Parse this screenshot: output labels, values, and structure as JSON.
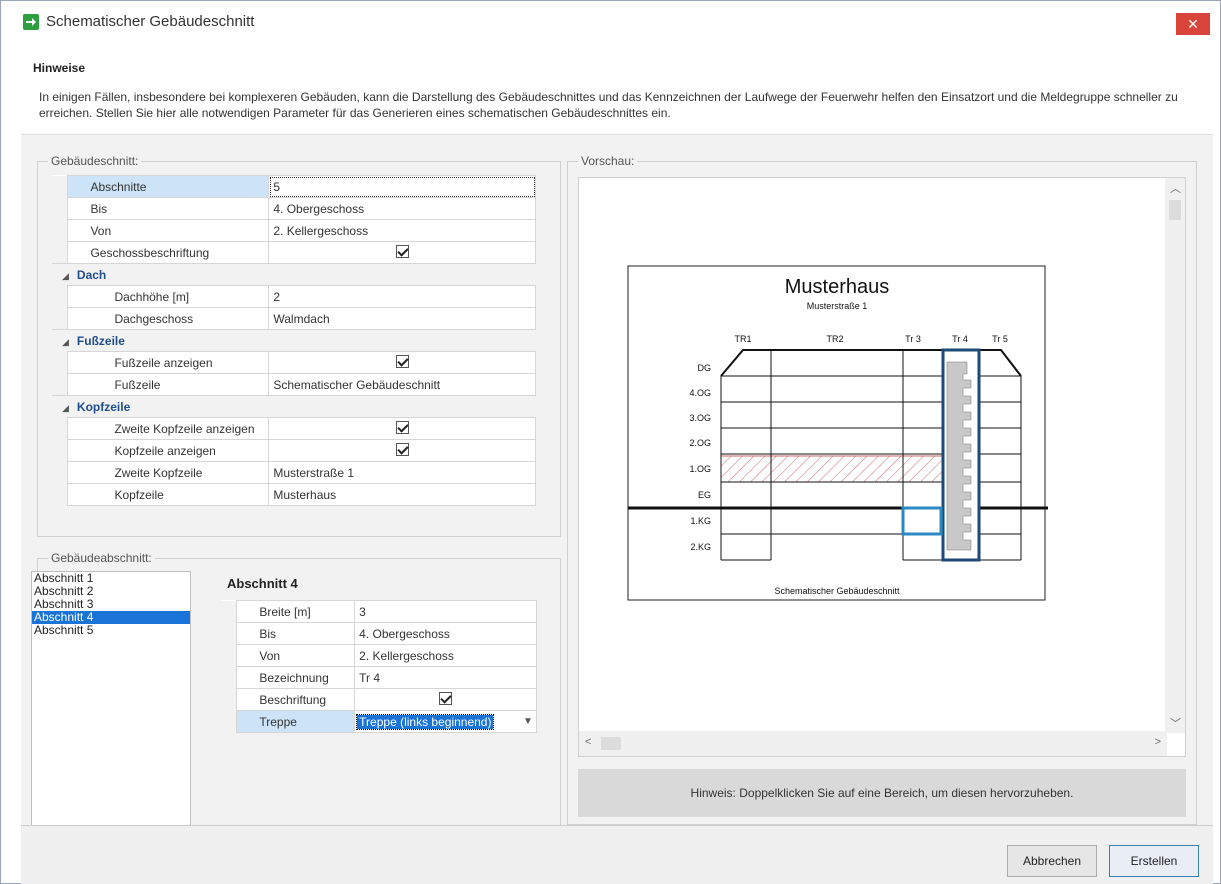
{
  "window": {
    "title": "Schematischer Gebäudeschnitt",
    "close": "✕"
  },
  "hinweise": {
    "title": "Hinweise",
    "text": "In einigen Fällen, insbesondere bei komplexeren Gebäuden, kann die Darstellung des Gebäudeschnittes und das Kennzeichnen der Laufwege der Feuerwehr helfen den Einsatzort und die Meldegruppe schneller zu erreichen. Stellen Sie hier alle notwendigen Parameter für das Generieren eines schematischen Gebäudeschnittes ein."
  },
  "gebaeudeschnitt": {
    "legend": "Gebäudeschnitt:",
    "rows": {
      "abschnitte": {
        "label": "Abschnitte",
        "value": "5"
      },
      "bis": {
        "label": "Bis",
        "value": "4. Obergeschoss"
      },
      "von": {
        "label": "Von",
        "value": "2. Kellergeschoss"
      },
      "geschossbeschriftung": {
        "label": "Geschossbeschriftung",
        "checked": true
      }
    },
    "dach": {
      "category": "Dach",
      "dachhoehe": {
        "label": "Dachhöhe [m]",
        "value": "2"
      },
      "dachgeschoss": {
        "label": "Dachgeschoss",
        "value": "Walmdach"
      }
    },
    "fusszeile": {
      "category": "Fußzeile",
      "anzeigen": {
        "label": "Fußzeile anzeigen",
        "checked": true
      },
      "text": {
        "label": "Fußzeile",
        "value": "Schematischer Gebäudeschnitt"
      }
    },
    "kopfzeile": {
      "category": "Kopfzeile",
      "zweite_anzeigen": {
        "label": "Zweite Kopfzeile anzeigen",
        "checked": true
      },
      "anzeigen": {
        "label": "Kopfzeile anzeigen",
        "checked": true
      },
      "zweite": {
        "label": "Zweite Kopfzeile",
        "value": "Musterstraße 1"
      },
      "text": {
        "label": "Kopfzeile",
        "value": "Musterhaus"
      }
    }
  },
  "gebaeudeabschnitt": {
    "legend": "Gebäudeabschnitt:",
    "list": [
      "Abschnitt 1",
      "Abschnitt 2",
      "Abschnitt 3",
      "Abschnitt 4",
      "Abschnitt 5"
    ],
    "selected_index": 3,
    "section_title": "Abschnitt 4",
    "props": {
      "breite": {
        "label": "Breite [m]",
        "value": "3"
      },
      "bis": {
        "label": "Bis",
        "value": "4. Obergeschoss"
      },
      "von": {
        "label": "Von",
        "value": "2. Kellergeschoss"
      },
      "bezeichnung": {
        "label": "Bezeichnung",
        "value": "Tr 4"
      },
      "beschriftung": {
        "label": "Beschriftung",
        "checked": true
      },
      "treppe": {
        "label": "Treppe",
        "value": "Treppe (links beginnend)"
      }
    }
  },
  "vorschau": {
    "legend": "Vorschau:",
    "drawing": {
      "title": "Musterhaus",
      "subtitle": "Musterstraße 1",
      "footer": "Schematischer Gebäudeschnitt",
      "sections": [
        "TR1",
        "TR2",
        "Tr 3",
        "Tr 4",
        "Tr 5"
      ],
      "floors": [
        "DG",
        "4.OG",
        "3.OG",
        "2.OG",
        "1.OG",
        "EG",
        "1.KG",
        "2.KG"
      ]
    },
    "hint": "Hinweis: Doppelklicken Sie auf eine Bereich, um diesen hervorzuheben."
  },
  "buttons": {
    "cancel": "Abbrechen",
    "create": "Erstellen"
  },
  "colors": {
    "accent": "#1a73d6",
    "close": "#d9453b",
    "highlight": "#1f4e8c",
    "stairs": "#1e4a78"
  }
}
